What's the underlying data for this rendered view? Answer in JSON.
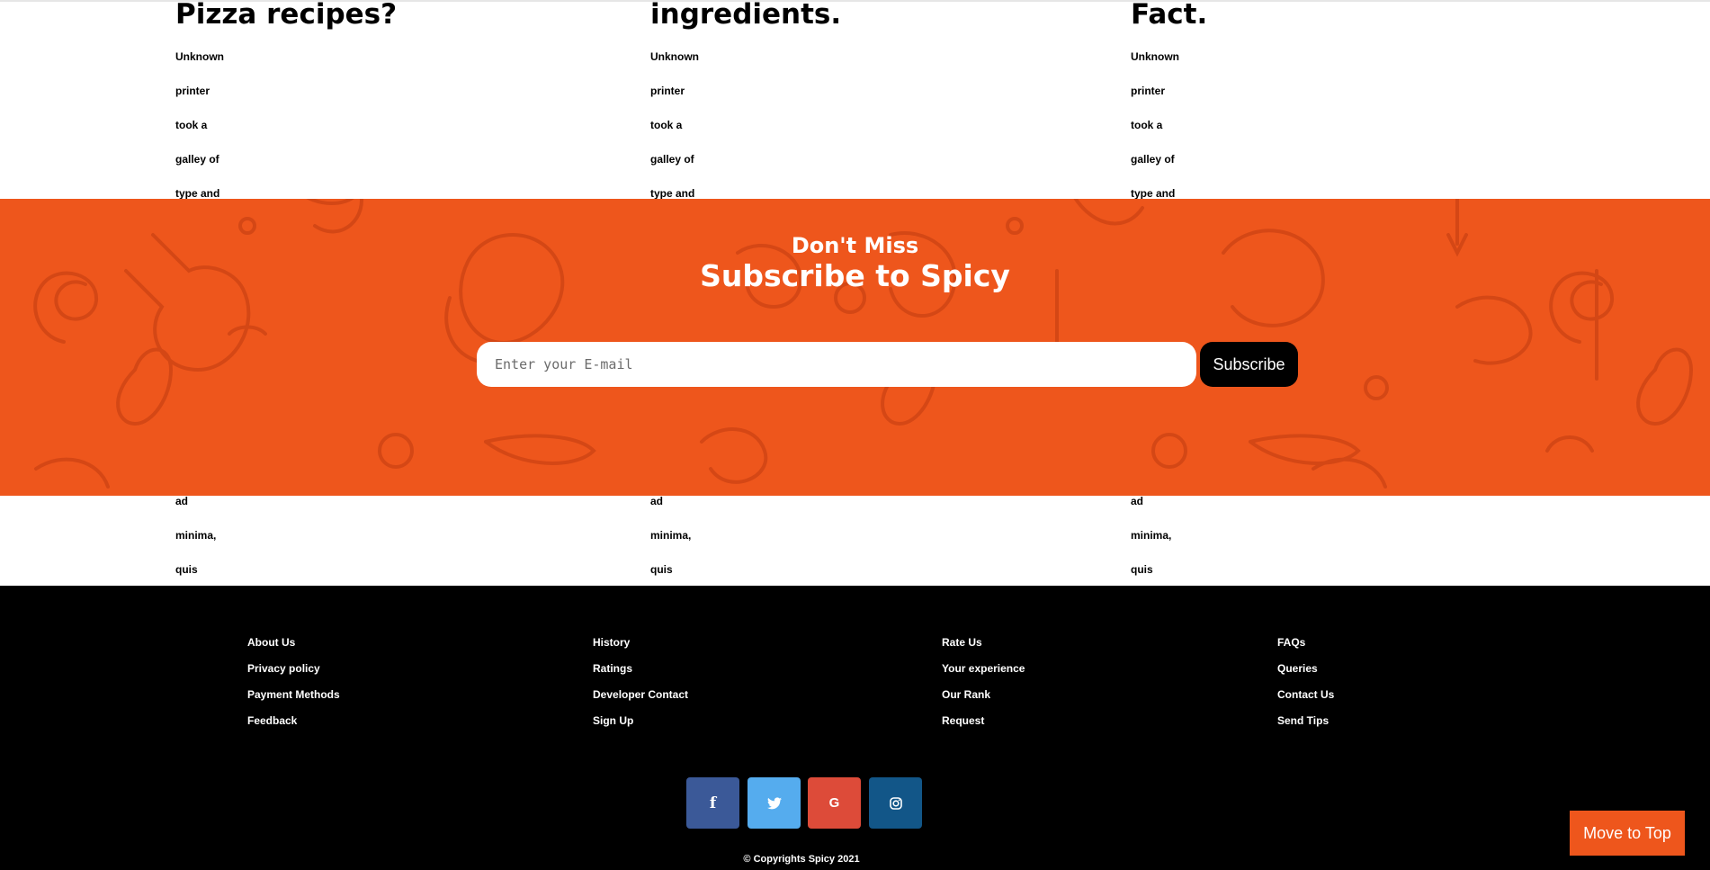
{
  "articles": [
    {
      "title": "Pizza recipes?",
      "line1": "Unknown printer took a galley of type and scrambled it to make a type specimen",
      "line2": "bookIt hasey survived Ut enim ad minima, quis nostrum onem."
    },
    {
      "title": "ingredients.",
      "line1": "Unknown printer took a galley of type and scrambled it to make a type",
      "line2": "specimen bookIt hasey survived Ut enim ad minima, quis nostrum onem."
    },
    {
      "title": "Fact.",
      "line1": "Unknown printer took a galley of type and scrambled it to make a type",
      "line2": "specimen bookIt hasey survived Ut enim ad minima, quis nostrum."
    }
  ],
  "subscribe": {
    "kicker": "Don't Miss",
    "title": "Subscribe to Spicy",
    "email_placeholder": "Enter your E-mail",
    "button_label": "Subscribe",
    "background_color": "#ee561c"
  },
  "footer": {
    "columns": [
      [
        "About Us",
        "Privacy policy",
        "Payment Methods",
        "Feedback"
      ],
      [
        "History",
        "Ratings",
        "Developer Contact",
        "Sign Up"
      ],
      [
        "Rate Us",
        "Your experience",
        "Our Rank",
        "Request"
      ],
      [
        "FAQs",
        "Queries",
        "Contact Us",
        "Send Tips"
      ]
    ],
    "socials": [
      {
        "name": "facebook",
        "glyph": "f",
        "color": "#3b5998",
        "icon": "facebook-icon"
      },
      {
        "name": "twitter",
        "glyph": "twitter-bird",
        "color": "#55acee",
        "icon": "twitter-icon"
      },
      {
        "name": "google",
        "glyph": "G",
        "color": "#dd4b39",
        "icon": "google-icon"
      },
      {
        "name": "instagram",
        "glyph": "instagram-camera",
        "color": "#125688",
        "icon": "instagram-icon"
      }
    ],
    "copyright": "© Copyrights Spicy 2021"
  },
  "move_to_top": {
    "label": "Move to Top"
  }
}
